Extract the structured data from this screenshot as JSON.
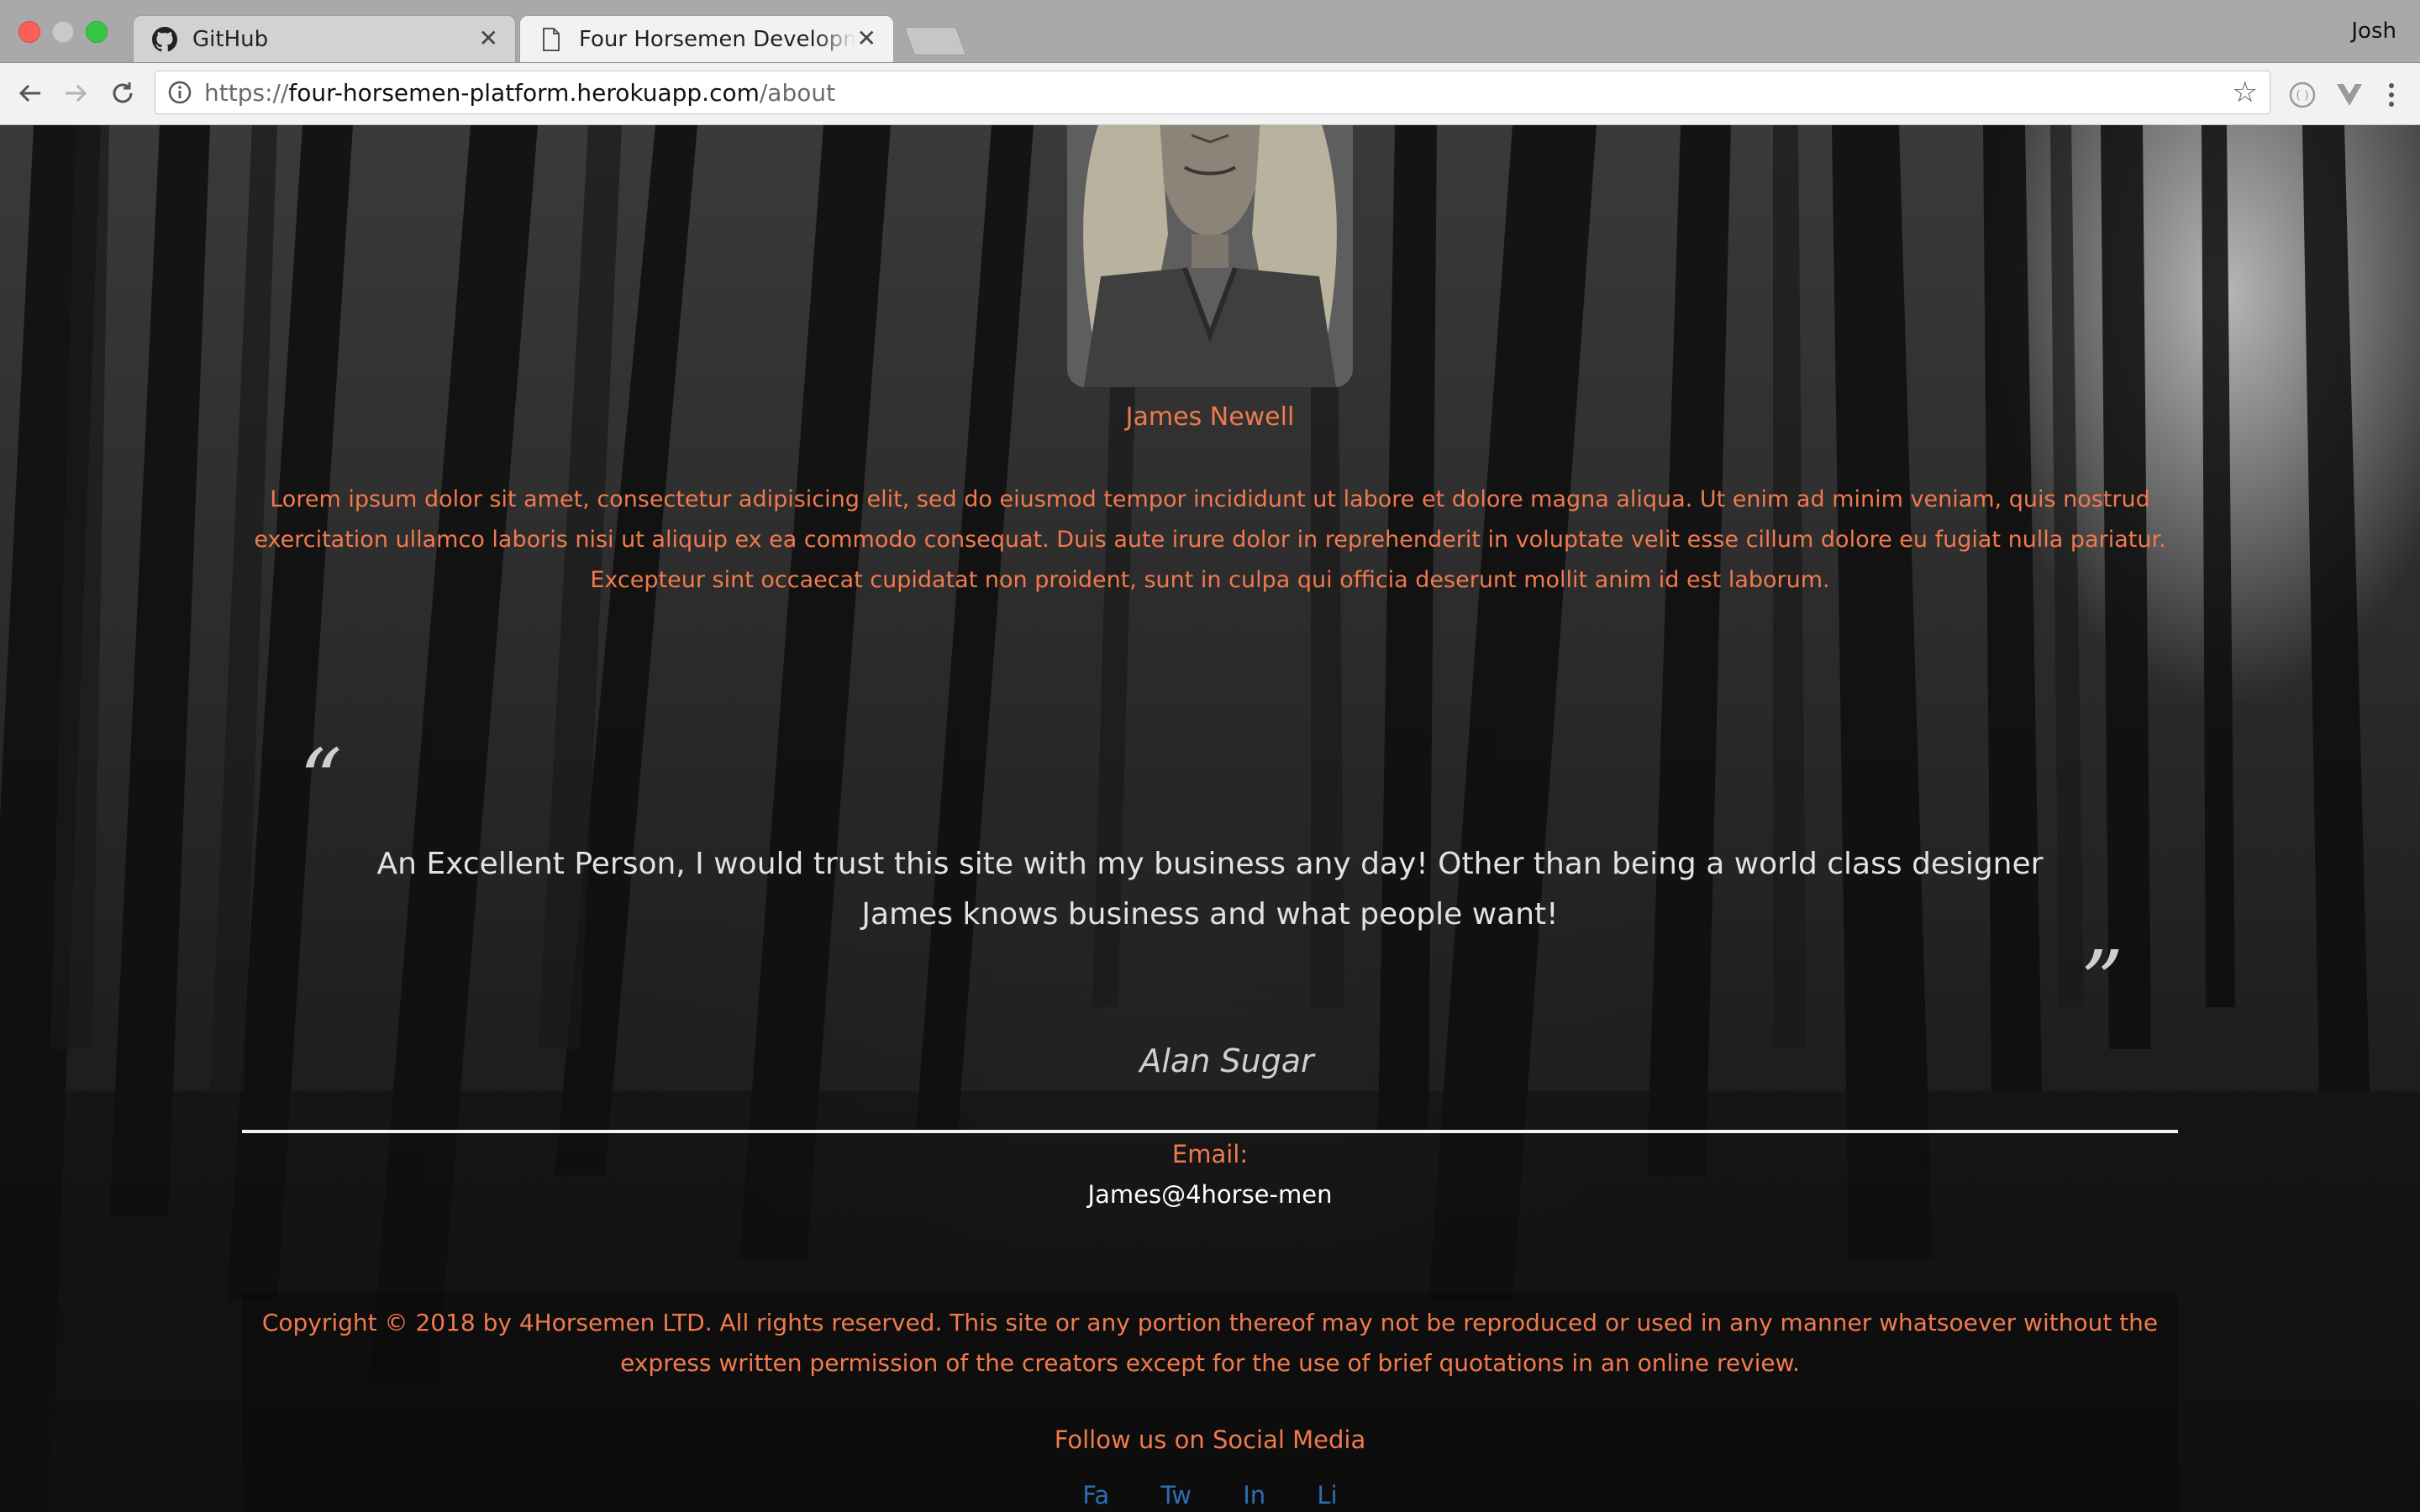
{
  "browser": {
    "tabs": [
      {
        "title": "GitHub",
        "icon": "github-icon",
        "active": false
      },
      {
        "title": "Four Horsemen Development P",
        "icon": "page-icon",
        "active": true
      }
    ],
    "profile_name": "Josh",
    "url": {
      "scheme": "https://",
      "host": "four-horsemen-platform.herokuapp.com",
      "path": "/about"
    }
  },
  "colors": {
    "accent": "#f07a4e",
    "link": "#2f6db3",
    "text_light": "#e2e2e2"
  },
  "profile": {
    "name": "James Newell",
    "bio": "Lorem ipsum dolor sit amet, consectetur adipisicing elit, sed do eiusmod tempor incididunt ut labore et dolore magna aliqua. Ut enim ad minim veniam, quis nostrud exercitation ullamco laboris nisi ut aliquip ex ea commodo consequat. Duis aute irure dolor in reprehenderit in voluptate velit esse cillum dolore eu fugiat nulla pariatur. Excepteur sint occaecat cupidatat non proident, sunt in culpa qui officia deserunt mollit anim id est laborum.",
    "email_label": "Email:",
    "email": "James@4horse-men"
  },
  "testimonial": {
    "open_quote": "“",
    "close_quote": "”",
    "text": "An Excellent Person, I would trust this site with my business any day! Other than being a world class designer James knows business and what people want!",
    "author": "Alan Sugar"
  },
  "footer": {
    "copyright": "Copyright © 2018 by 4Horsemen LTD. All rights reserved. This site or any portion thereof may not be reproduced or used in any manner whatsoever without the express written permission of the creators except for the use of brief quotations in an online review.",
    "follow": "Follow us on Social Media",
    "social": [
      "Fa",
      "Tw",
      "In",
      "Li"
    ]
  }
}
